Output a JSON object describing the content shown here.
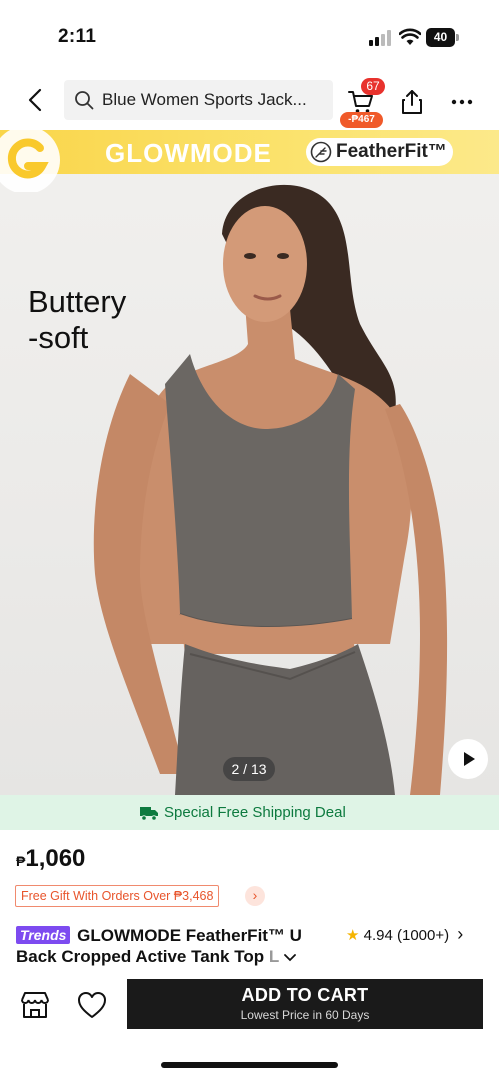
{
  "status_bar": {
    "time": "2:11",
    "battery": "40"
  },
  "header": {
    "search_text": "Blue Women Sports Jack...",
    "cart_count": "67",
    "cart_discount": "-₱467"
  },
  "hero": {
    "brand_name": "GLOWMODE",
    "brand_sub": "FeatherFit™",
    "overlay_line1": "Buttery",
    "overlay_line2": "-soft",
    "page_indicator": "2 / 13"
  },
  "shipping": {
    "text": "Special Free Shipping Deal"
  },
  "product": {
    "currency": "₱",
    "price": "1,060",
    "gift_text": "Free Gift With Orders Over ₱3,468",
    "gift_arrow": "›",
    "trends_badge": "Trends",
    "title_main": "GLOWMODE FeatherFit™ U Back Cropped Active Tank Top",
    "title_fade": " L",
    "rating_star": "★",
    "rating": "4.94 (1000+)",
    "rating_arrow": "›"
  },
  "bottom_bar": {
    "add_to_cart": "ADD TO CART",
    "add_to_cart_sub": "Lowest Price in 60 Days"
  },
  "colors": {
    "accent_red": "#e8322d",
    "brand_yellow": "#f9d54a",
    "shipping_green": "#0d7a3f",
    "trends_purple": "#7d4bf0"
  }
}
